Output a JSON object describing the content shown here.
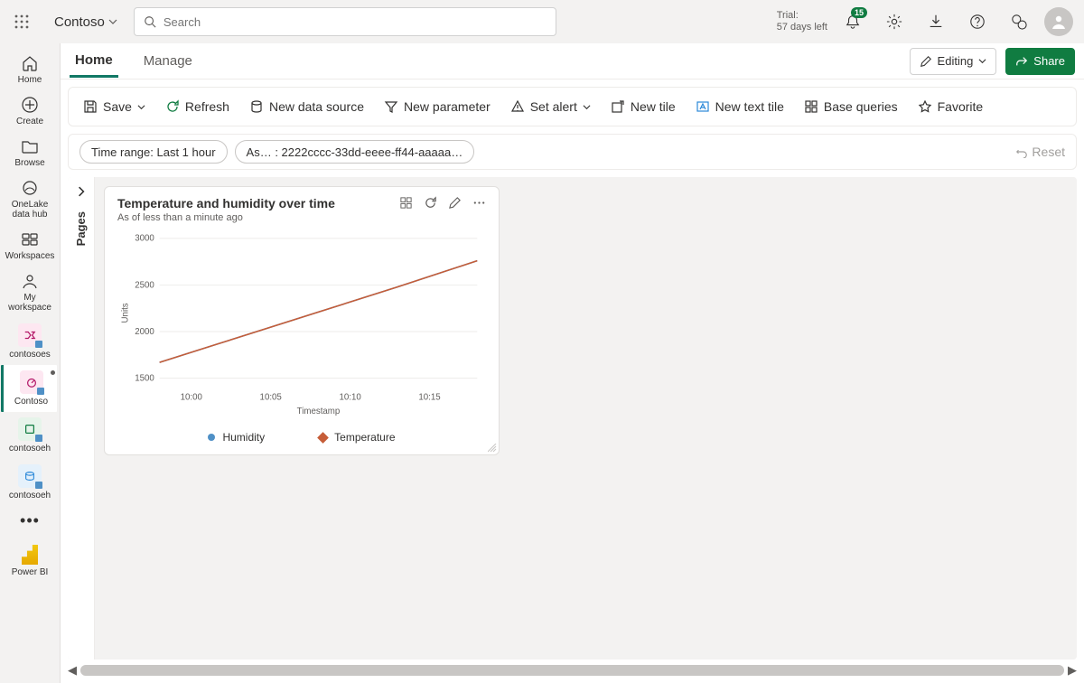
{
  "top": {
    "workspace": "Contoso",
    "search_placeholder": "Search",
    "trial_line1": "Trial:",
    "trial_line2": "57 days left",
    "notif_badge": "15"
  },
  "leftnav": {
    "items": [
      {
        "label": "Home"
      },
      {
        "label": "Create"
      },
      {
        "label": "Browse"
      },
      {
        "label": "OneLake data hub"
      },
      {
        "label": "Workspaces"
      },
      {
        "label": "My workspace"
      },
      {
        "label": "contosoes"
      },
      {
        "label": "Contoso"
      },
      {
        "label": "contosoeh"
      },
      {
        "label": "contosoeh"
      },
      {
        "label": "Power BI"
      }
    ]
  },
  "tabs": {
    "home": "Home",
    "manage": "Manage",
    "editing": "Editing",
    "share": "Share"
  },
  "cmd": {
    "save": "Save",
    "refresh": "Refresh",
    "new_data": "New data source",
    "new_param": "New parameter",
    "set_alert": "Set alert",
    "new_tile": "New tile",
    "new_text_tile": "New text tile",
    "base_queries": "Base queries",
    "favorite": "Favorite"
  },
  "filters": {
    "time_range": "Time range: Last 1 hour",
    "asset": "As… : 2222cccc-33dd-eeee-ff44-aaaaa…",
    "reset": "Reset"
  },
  "pages_label": "Pages",
  "tile": {
    "title": "Temperature and humidity over time",
    "subtitle": "As of less than a minute ago",
    "legend_humidity": "Humidity",
    "legend_temperature": "Temperature"
  },
  "chart_data": {
    "type": "line",
    "title": "Temperature and humidity over time",
    "xlabel": "Timestamp",
    "ylabel": "Units",
    "ylim": [
      1400,
      3000
    ],
    "x_ticks": [
      "10:00",
      "10:05",
      "10:10",
      "10:15"
    ],
    "y_ticks": [
      1500,
      2000,
      2500,
      3000
    ],
    "series": [
      {
        "name": "Humidity",
        "color": "#4f90c6",
        "values": [
          1670,
          1940,
          2210,
          2480,
          2760
        ]
      },
      {
        "name": "Temperature",
        "color": "#c65d38",
        "values": [
          1670,
          1940,
          2210,
          2480,
          2760
        ]
      }
    ],
    "x": [
      "09:59",
      "10:04",
      "10:09",
      "10:14",
      "10:19"
    ]
  }
}
